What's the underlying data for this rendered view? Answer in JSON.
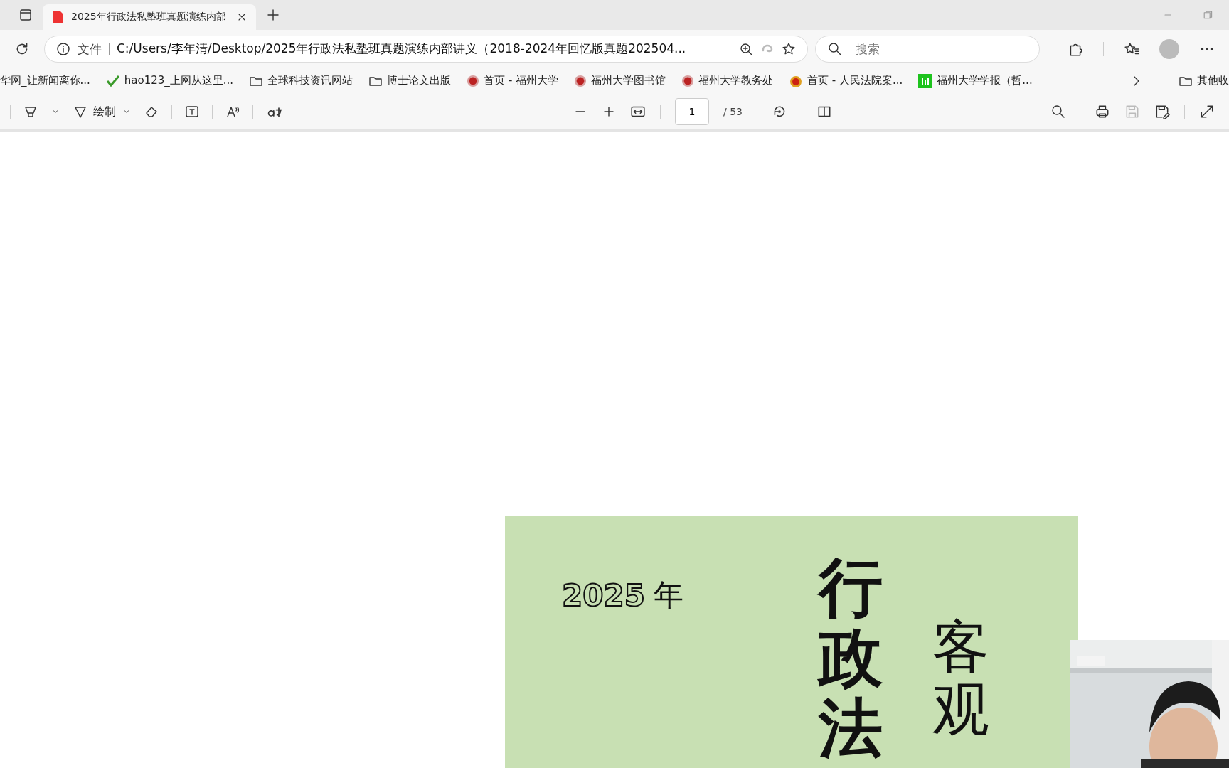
{
  "tabs": [
    {
      "title": "2025年行政法私塾班真题演练内部",
      "selected": true
    }
  ],
  "address_bar": {
    "security_label": "文件",
    "url": "C:/Users/李年清/Desktop/2025年行政法私塾班真题演练内部讲义（2018-2024年回忆版真题202504..."
  },
  "search": {
    "placeholder": "搜索"
  },
  "bookmarks": [
    {
      "label": "华网_让新闻离你...",
      "kind": "plain"
    },
    {
      "label": "hao123_上网从这里...",
      "kind": "check"
    },
    {
      "label": "全球科技资讯网站",
      "kind": "folder"
    },
    {
      "label": "博士论文出版",
      "kind": "folder"
    },
    {
      "label": "首页 - 福州大学",
      "kind": "emblem"
    },
    {
      "label": "福州大学图书馆",
      "kind": "emblem"
    },
    {
      "label": "福州大学教务处",
      "kind": "emblem"
    },
    {
      "label": "首页 - 人民法院案...",
      "kind": "court"
    },
    {
      "label": "福州大学学报（哲...",
      "kind": "square"
    }
  ],
  "other_bookmarks": "其他收",
  "pdf_toolbar": {
    "draw_label": "绘制",
    "page": "1",
    "page_total": "/ 53"
  },
  "cover": {
    "year": "2025",
    "year_suffix": "年",
    "title": "行政法",
    "subtitle": "客观"
  }
}
